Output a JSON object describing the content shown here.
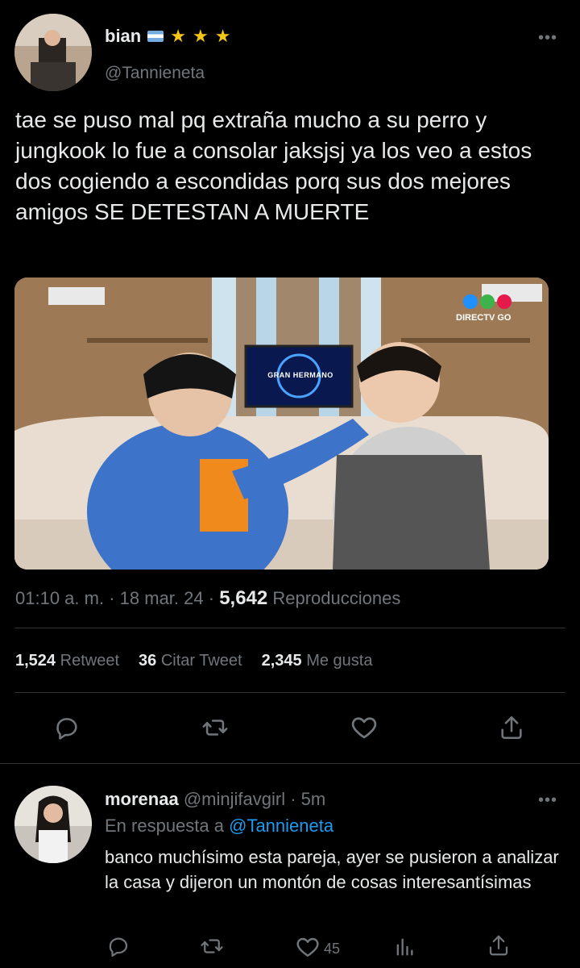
{
  "tweet": {
    "author_name": "bian",
    "author_handle": "@Tannieneta",
    "text": "tae se puso mal pq extraña mucho a su perro y jungkook lo fue a consolar jaksjsj ya los veo a estos dos cogiendo a escondidas porq sus dos mejores amigos SE DETESTAN A MUERTE",
    "media": {
      "tv_logo_text": "GRAN HERMANO",
      "broadcaster_logo_text": "DIRECTV GO"
    },
    "time": "01:10 a. m.",
    "date": "18 mar. 24",
    "views_count": "5,642",
    "views_label": "Reproducciones",
    "stats": {
      "retweets_count": "1,524",
      "retweets_label": "Retweet",
      "quotes_count": "36",
      "quotes_label": "Citar Tweet",
      "likes_count": "2,345",
      "likes_label": "Me gusta"
    }
  },
  "reply": {
    "author_name": "morenaa",
    "author_handle": "@minjifavgirl",
    "time_ago": "5m",
    "in_reply_prefix": "En respuesta a",
    "in_reply_handle": "@Tannieneta",
    "text": "banco muchísimo esta pareja, ayer se pusieron a analizar la casa y dijeron un montón de cosas interesantísimas",
    "likes_count": "45"
  },
  "colors": {
    "background": "#000000",
    "text": "#e7e9ea",
    "muted": "#71767b",
    "accent": "#1d9bf0",
    "divider": "#2f3336"
  }
}
